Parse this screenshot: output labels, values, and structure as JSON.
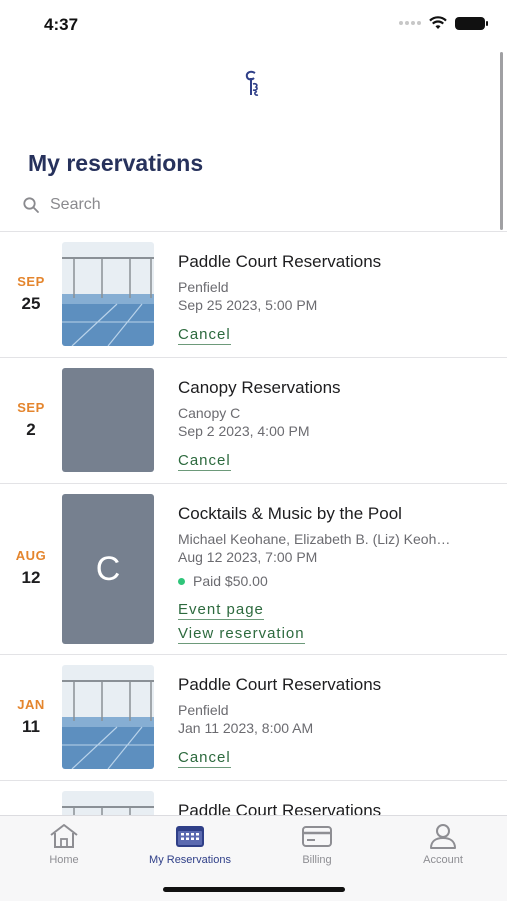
{
  "status_bar": {
    "time": "4:37"
  },
  "header": {
    "title": "My reservations"
  },
  "search": {
    "placeholder": "Search"
  },
  "reservations": [
    {
      "month": "SEP",
      "day": "25",
      "title": "Paddle Court Reservations",
      "location": "Penfield",
      "datetime": "Sep 25 2023, 5:00 PM",
      "actions": [
        "Cancel"
      ]
    },
    {
      "month": "SEP",
      "day": "2",
      "title": "Canopy Reservations",
      "location": "Canopy C",
      "datetime": "Sep 2 2023, 4:00 PM",
      "actions": [
        "Cancel"
      ]
    },
    {
      "month": "AUG",
      "day": "12",
      "title": "Cocktails & Music by the Pool",
      "guests": "Michael Keohane, Elizabeth B. (Liz) Keoh…",
      "datetime": "Aug 12 2023, 7:00 PM",
      "payment": "Paid $50.00",
      "thumb_letter": "C",
      "actions": [
        "Event page",
        "View reservation"
      ]
    },
    {
      "month": "JAN",
      "day": "11",
      "title": "Paddle Court Reservations",
      "location": "Penfield",
      "datetime": "Jan 11 2023, 8:00 AM",
      "actions": [
        "Cancel"
      ]
    },
    {
      "title": "Paddle Court Reservations"
    }
  ],
  "tabbar": {
    "tabs": [
      {
        "label": "Home",
        "icon": "home-icon"
      },
      {
        "label": "My Reservations",
        "icon": "calendar-icon",
        "active": true
      },
      {
        "label": "Billing",
        "icon": "credit-card-icon"
      },
      {
        "label": "Account",
        "icon": "person-icon"
      }
    ]
  },
  "colors": {
    "title": "#27325c",
    "month": "#e4852d",
    "link": "#2d6a3e",
    "active_tab": "#2f3f88",
    "paid_dot": "#2fc57a"
  }
}
